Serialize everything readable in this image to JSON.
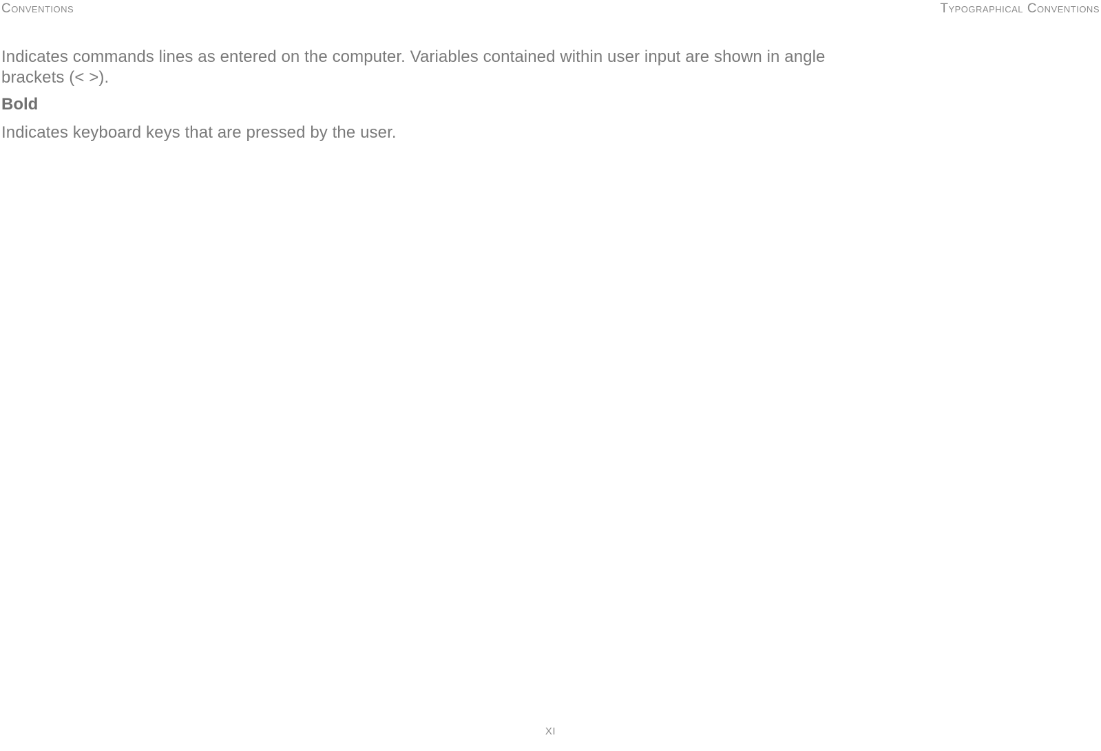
{
  "header": {
    "left": "Conventions",
    "right": "Typographical Conventions"
  },
  "content": {
    "para1": "Indicates commands lines as entered on the computer. Variables contained within user input are shown in angle brackets (< >).",
    "bold_heading": "Bold",
    "para2": "Indicates keyboard keys that are pressed by the user."
  },
  "page_number": "XI"
}
